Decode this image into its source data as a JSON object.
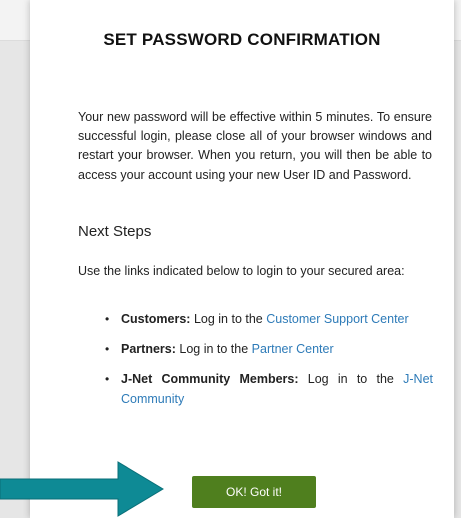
{
  "dialog": {
    "title": "SET PASSWORD CONFIRMATION",
    "body": "Your new password will be effective within 5 minutes. To ensure successful login, please close all of your browser windows and restart your browser. When you return, you will then be able to access your account using your new User ID and Password.",
    "next_steps_heading": "Next Steps",
    "links_intro": "Use the links indicated below to login to your secured area:",
    "items": [
      {
        "label": "Customers:",
        "text": " Log in to the ",
        "link": "Customer Support Center"
      },
      {
        "label": "Partners:",
        "text": " Log in to the ",
        "link": "Partner Center"
      },
      {
        "label": "J-Net Community Members:",
        "text": " Log in to the ",
        "link": "J-Net Community"
      }
    ],
    "ok_button_label": "OK! Got it!"
  },
  "colors": {
    "button_bg": "#4f7f1e",
    "link": "#2e7bb8",
    "arrow": "#0e8a95"
  }
}
